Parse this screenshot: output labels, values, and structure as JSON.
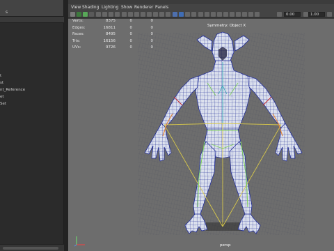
{
  "outliner": {
    "title": "s",
    "items": [
      "",
      "",
      "",
      "",
      "",
      "",
      "",
      "t",
      "st",
      "nt_Reference",
      "et",
      "Set"
    ]
  },
  "menu": [
    "View",
    "Shading",
    "Lighting",
    "Show",
    "Renderer",
    "Panels"
  ],
  "toolbar": {
    "field1": "0.00",
    "field2": "1.00"
  },
  "hud": {
    "rows": [
      {
        "label": "Verts:",
        "v1": "8375",
        "v2": "0",
        "v3": "0"
      },
      {
        "label": "Edges:",
        "v1": "16811",
        "v2": "0",
        "v3": "0"
      },
      {
        "label": "Faces:",
        "v1": "8495",
        "v2": "0",
        "v3": "0"
      },
      {
        "label": "Tris:",
        "v1": "16156",
        "v2": "0",
        "v3": "0"
      },
      {
        "label": "UVs:",
        "v1": "9726",
        "v2": "0",
        "v3": "0"
      }
    ]
  },
  "symmetry": "Symmetry: Object X",
  "camera": "persp",
  "colors": {
    "viewport": "#6d6d6d",
    "mesh_fill": "#dde2ee",
    "mesh_wire": "#232f9a",
    "edge_green": "#7fd05a",
    "edge_yellow": "#d8c84a",
    "edge_orange": "#e0843a",
    "edge_red": "#c43030"
  }
}
